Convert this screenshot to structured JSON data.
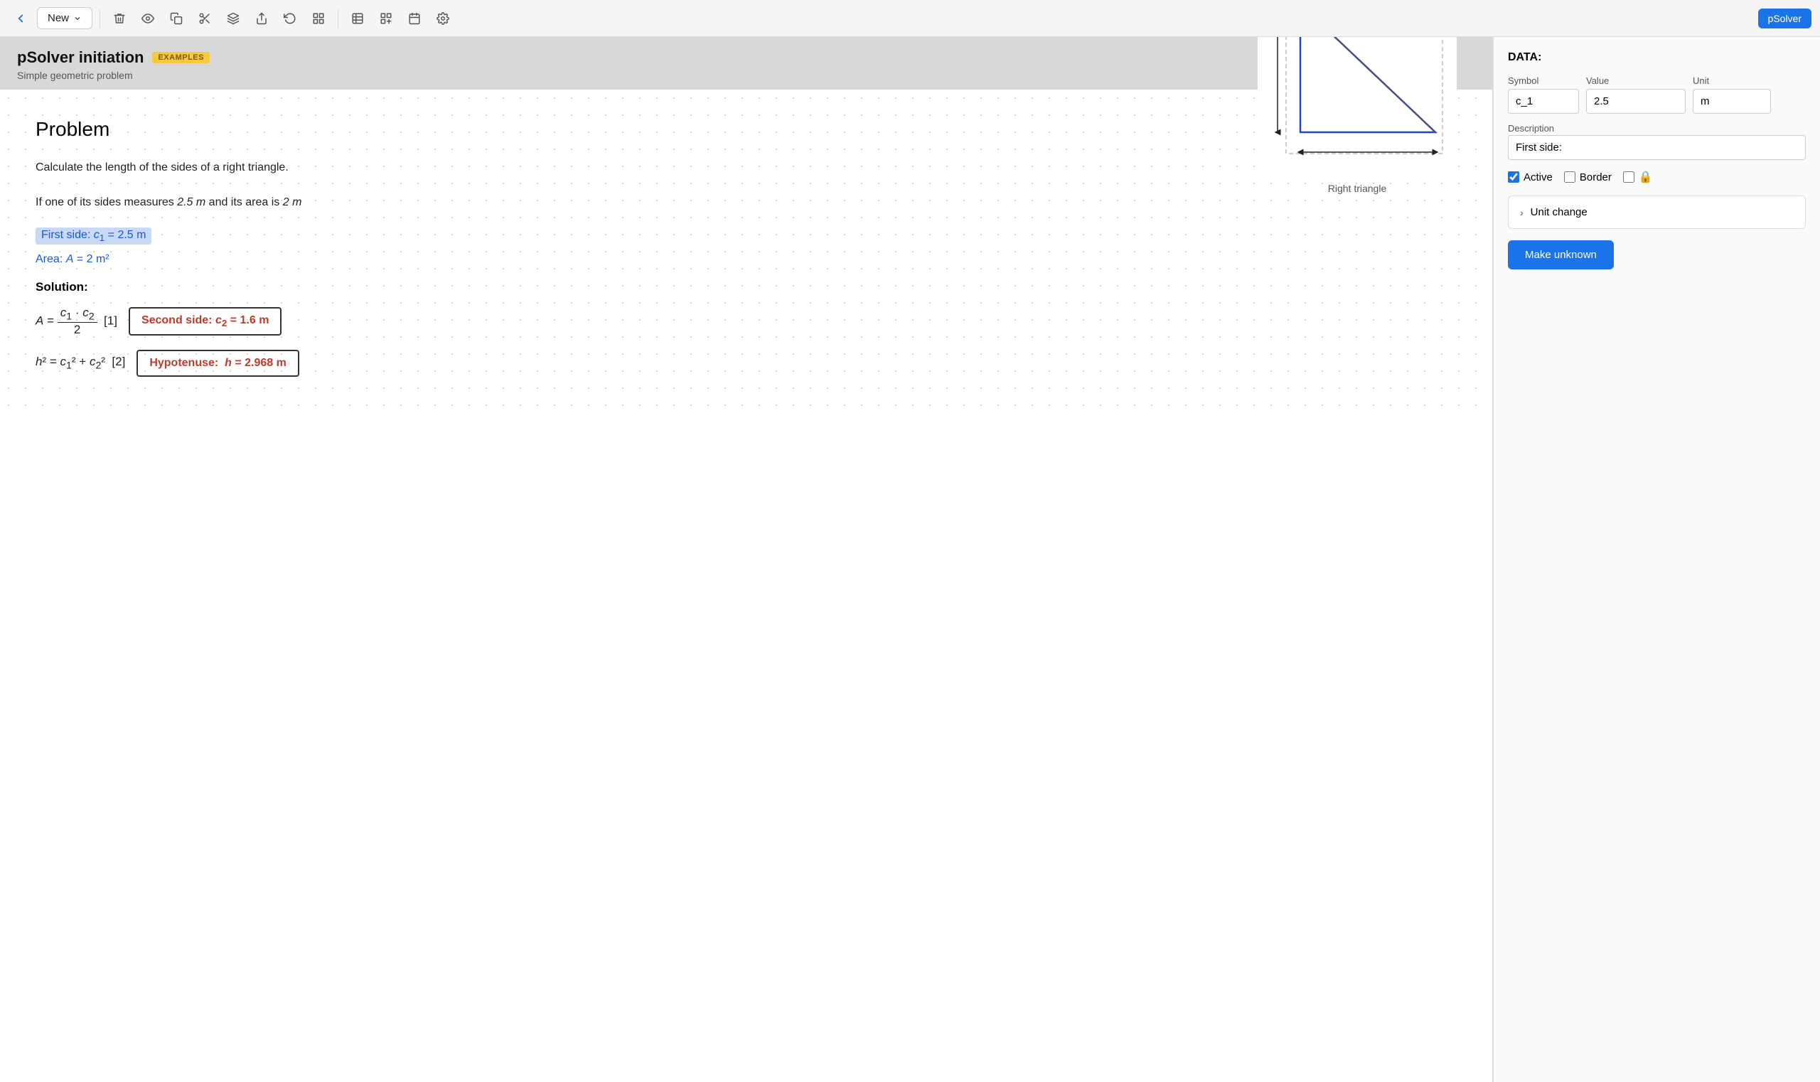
{
  "toolbar": {
    "new_label": "New",
    "user_label": "pSolver"
  },
  "document": {
    "title": "pSolver initiation",
    "badge": "EXAMPLES",
    "subtitle": "Simple geometric problem"
  },
  "content": {
    "problem_heading": "Problem",
    "problem_line1": "Calculate the length of the sides of a right triangle.",
    "problem_line2_prefix": "If one of its sides measures ",
    "problem_line2_value": "2.5 m",
    "problem_line2_middle": " and its area is ",
    "problem_line2_value2": "2 m",
    "given_1": "First side: c₁ = 2.5 m",
    "given_2": "Area: A = 2 m²",
    "solution_heading": "Solution:",
    "formula_1": "A = (c₁ · c₂) / 2  [1]",
    "result_1": "Second side: c₂ = 1.6 m",
    "formula_2": "h² = c₁² + c₂²  [2]",
    "result_2": "Hypotenuse: h = 2.968 m",
    "diagram_label": "Right triangle"
  },
  "data_panel": {
    "section_label": "DATA:",
    "symbol_label": "Symbol",
    "value_label": "Value",
    "unit_label": "Unit",
    "symbol_value": "c_1",
    "value_value": "2.5",
    "unit_value": "m",
    "description_label": "Description",
    "description_value": "First side:",
    "active_label": "Active",
    "border_label": "Border",
    "unit_change_label": "Unit change",
    "make_unknown_label": "Make unknown"
  }
}
